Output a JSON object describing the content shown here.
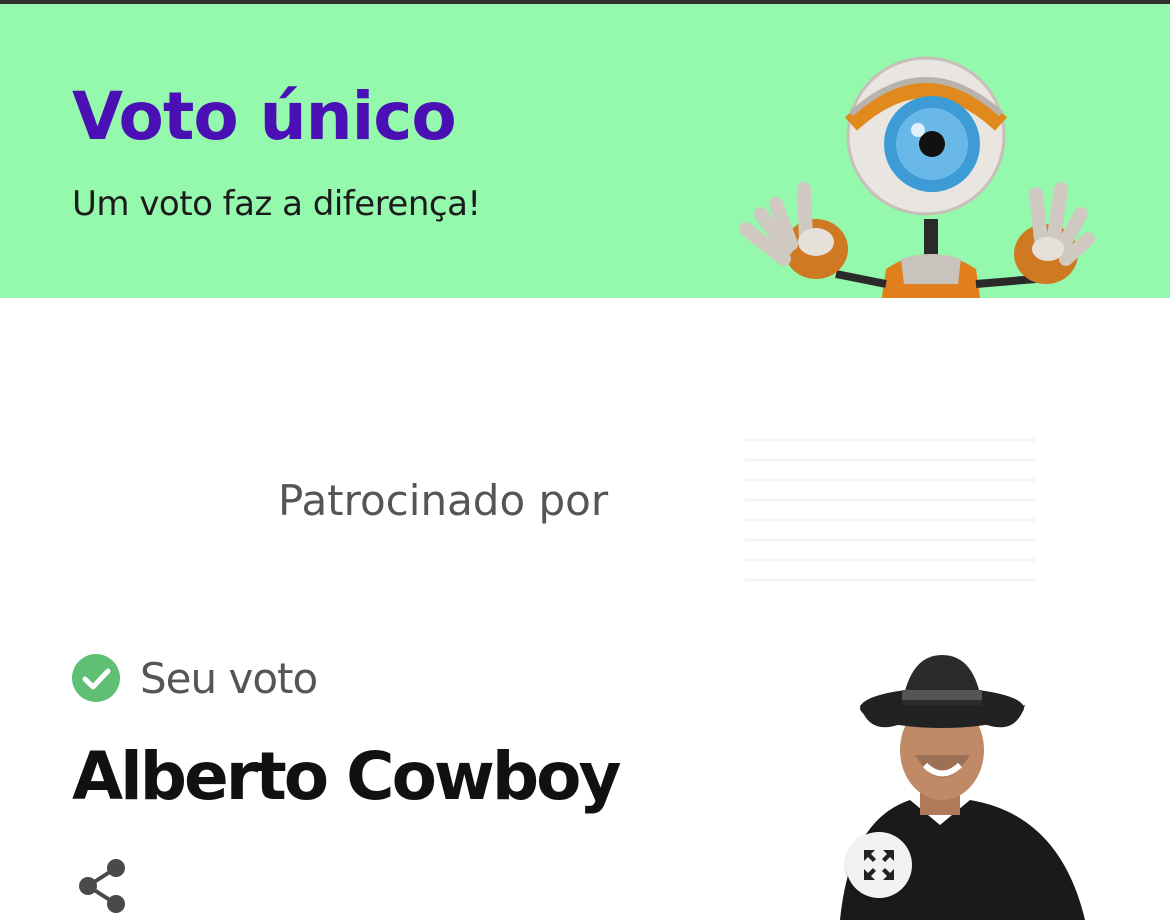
{
  "header": {
    "title": "Voto único",
    "subtitle": "Um voto faz a diferença!",
    "background_color": "#95f9ad",
    "title_color": "#4a0fb5",
    "mascot_icon": "big-brother-eye-mascot"
  },
  "sponsor": {
    "label": "Patrocinado por",
    "logo_icon": "sponsor-logo"
  },
  "vote": {
    "status_icon": "check-circle-icon",
    "status_label": "Seu voto",
    "status_color": "#5fbf72",
    "candidate_name": "Alberto Cowboy",
    "share_icon": "share-icon",
    "expand_icon": "expand-icon"
  }
}
